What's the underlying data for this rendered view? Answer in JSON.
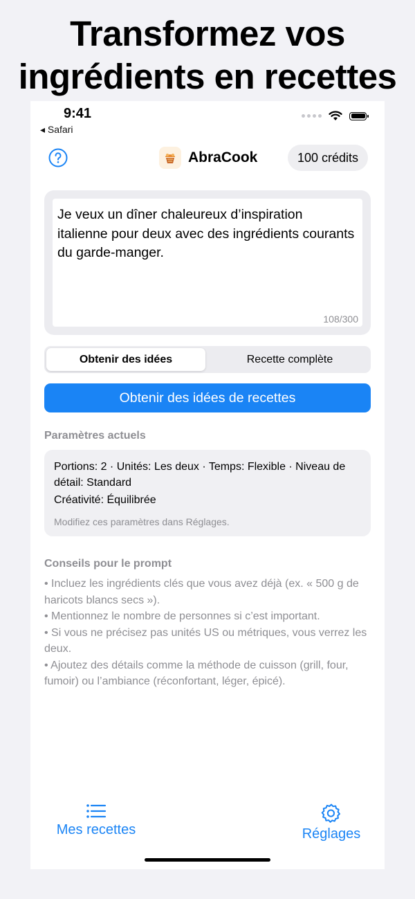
{
  "headline": {
    "line1": "Transformez vos",
    "line2": "ingrédients en recettes"
  },
  "status_bar": {
    "time": "9:41",
    "back_app": "◂ Safari"
  },
  "header": {
    "app_name": "AbraCook",
    "credits": "100 crédits"
  },
  "prompt": {
    "text": "Je veux un dîner chaleureux d’inspiration italienne pour deux avec des ingrédients courants du garde-manger.",
    "counter": "108/300"
  },
  "segment": {
    "options": [
      "Obtenir des idées",
      "Recette complète"
    ],
    "selected": "Obtenir des idées"
  },
  "primary_button": "Obtenir des idées de recettes",
  "current_params": {
    "title": "Paramètres actuels",
    "summary": "Portions: 2 · Unités: Les deux · Temps: Flexible · Niveau de détail: Standard",
    "creativity": "Créativité: Équilibrée",
    "note": "Modifiez ces paramètres dans Réglages."
  },
  "tips": {
    "title": "Conseils pour le prompt",
    "items": [
      "• Incluez les ingrédients clés que vous avez déjà (ex. « 500 g de haricots blancs secs »).",
      "• Mentionnez le nombre de personnes si c’est important.",
      "• Si vous ne précisez pas unités US ou métriques, vous verrez les deux.",
      "• Ajoutez des détails comme la méthode de cuisson (grill, four, fumoir) ou l’ambiance (réconfortant, léger, épicé)."
    ]
  },
  "tab_bar": {
    "recipes": "Mes recettes",
    "settings": "Réglages"
  },
  "colors": {
    "accent": "#1a84f5",
    "background": "#f2f2f6",
    "card": "#ececf0",
    "secondary_text": "#8e8e93"
  },
  "icons": [
    "help-circle-icon",
    "abracook-logo-icon",
    "wifi-icon",
    "battery-icon",
    "list-icon",
    "gear-icon"
  ]
}
